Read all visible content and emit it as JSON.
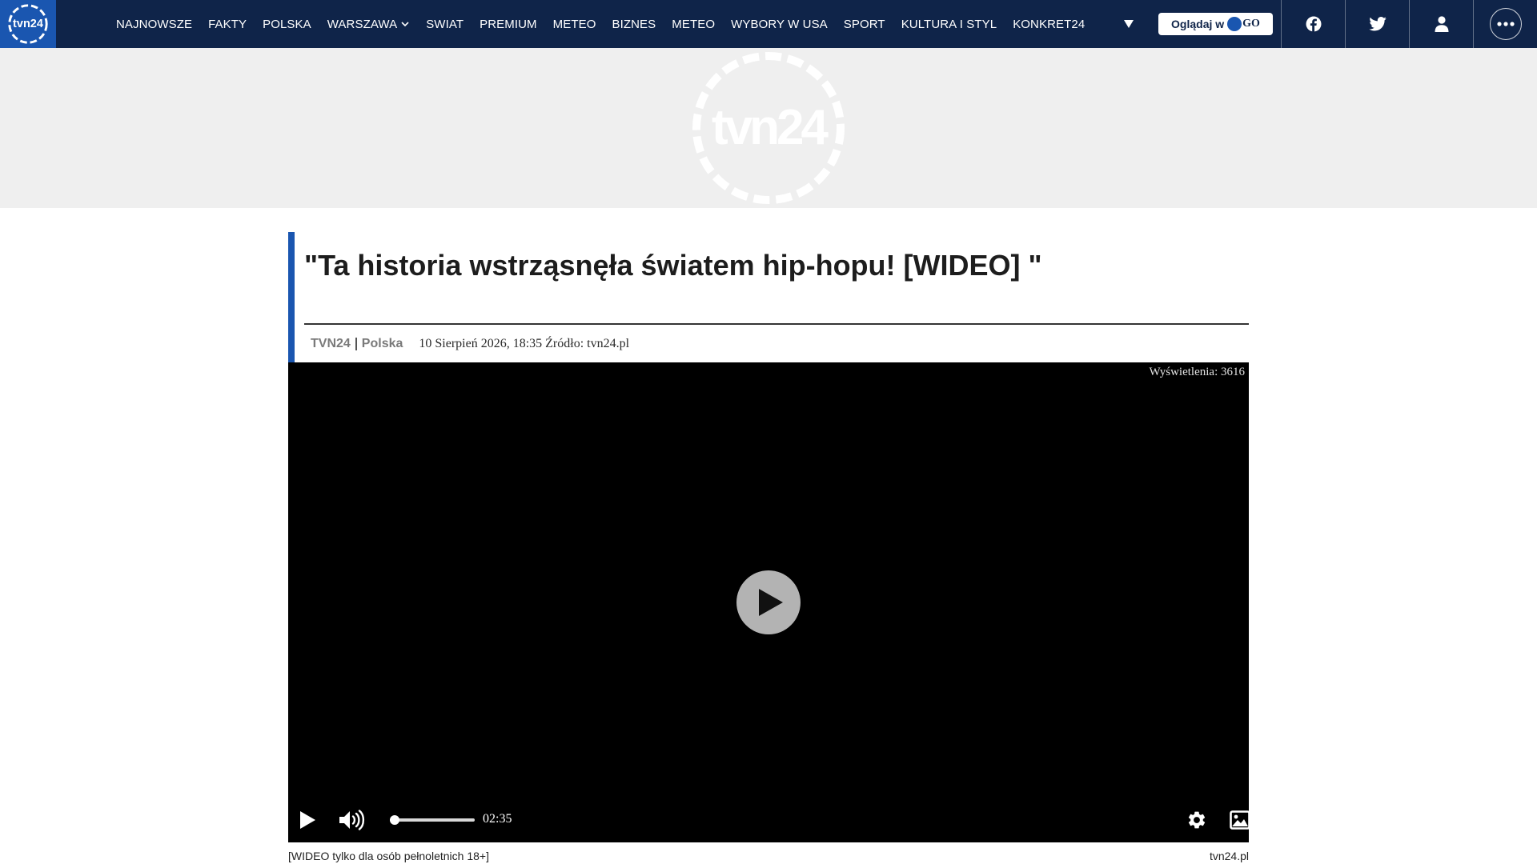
{
  "nav": {
    "logo_text": "tvn24",
    "links": [
      {
        "label": "NAJNOWSZE"
      },
      {
        "label": "FAKTY"
      },
      {
        "label": "POLSKA"
      },
      {
        "label": "WARSZAWA",
        "has_dropdown": true
      },
      {
        "label": "SWIAT"
      },
      {
        "label": "PREMIUM"
      },
      {
        "label": "METEO"
      },
      {
        "label": "BIZNES"
      },
      {
        "label": "METEO"
      },
      {
        "label": "WYBORY W USA"
      },
      {
        "label": "SPORT"
      },
      {
        "label": "KULTURA I STYL"
      },
      {
        "label": "KONKRET24"
      }
    ],
    "go_button": {
      "label": "Oglądaj w",
      "suffix": "GO"
    },
    "icons": [
      "triangle-down-icon",
      "facebook-icon",
      "twitter-icon",
      "user-icon",
      "more-icon"
    ],
    "colors": {
      "background": "#0f2449",
      "logo_bg": "#1a56b0",
      "accent": "#1a56b0"
    }
  },
  "article": {
    "title": "\"Ta historia wstrząsnęła światem hip-hopu! [WIDEO] \"",
    "brand": "TVN24",
    "section": "Polska",
    "date_source": "10 Sierpień 2026, 18:35 Źródło: tvn24.pl"
  },
  "video": {
    "views": "Wyświetlenia: 3616",
    "duration": "02:35",
    "progress": 0,
    "caption": "[WIDEO tylko dla osób pełnoletnich 18+]",
    "source": "tvn24.pl",
    "icons": [
      "play-icon",
      "volume-icon",
      "settings-icon",
      "image-icon"
    ]
  }
}
